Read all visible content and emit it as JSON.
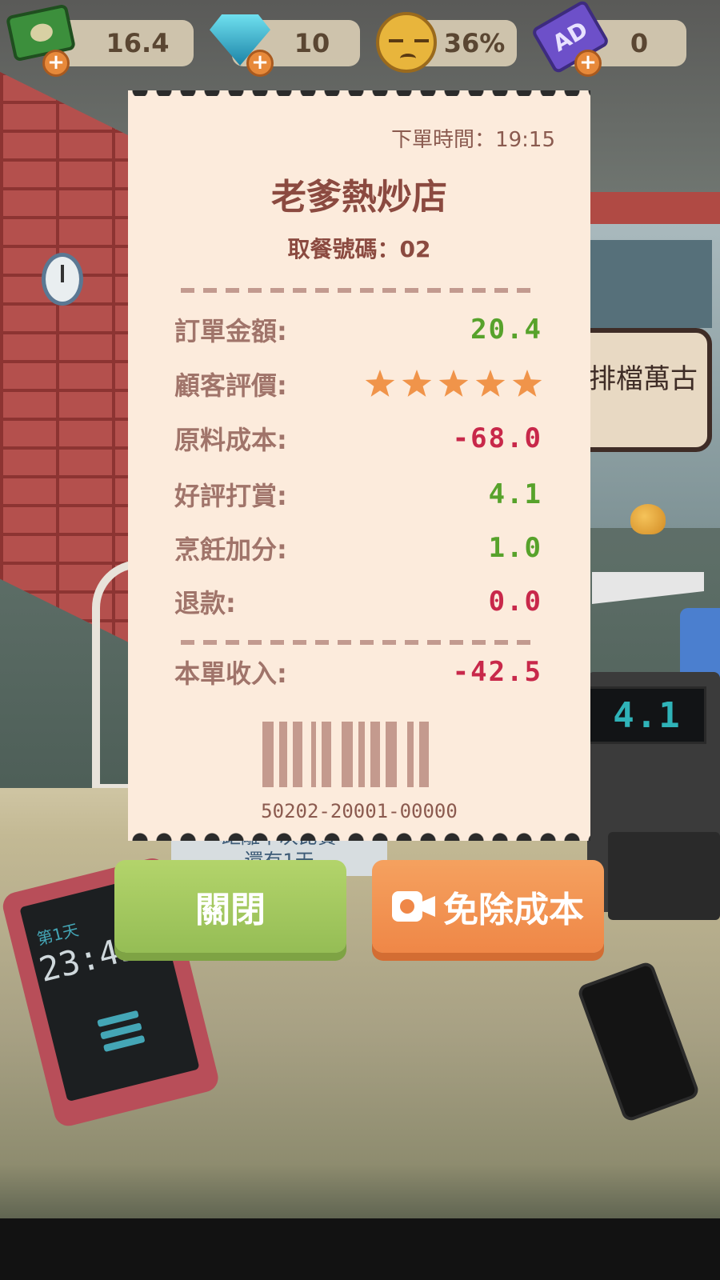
{
  "hud": {
    "cash": "16.4",
    "gems": "10",
    "satisfaction": "36%",
    "ad_tickets": "0",
    "ad_icon_text": "AD"
  },
  "scene": {
    "side_sign": "排檔萬古",
    "next_match_line1": "距離下次比賽",
    "next_match_line2": "還有1天",
    "register_display": "4.1",
    "tablet_day": "第1天",
    "tablet_time": "23:45"
  },
  "receipt": {
    "order_time_label": "下單時間：",
    "order_time": "19:15",
    "shop_name": "老爹熱炒店",
    "pickup_label": "取餐號碼：",
    "pickup_number": "02",
    "rows": [
      {
        "label": "訂單金額:",
        "value": "20.4"
      },
      {
        "label": "顧客評價:",
        "stars": 5
      },
      {
        "label": "原料成本:",
        "value": "-68.0"
      },
      {
        "label": "好評打賞:",
        "value": "4.1"
      },
      {
        "label": "烹飪加分:",
        "value": "1.0"
      },
      {
        "label": "退款:",
        "value": "0.0"
      }
    ],
    "total_label": "本單收入:",
    "total_value": "-42.5",
    "barcode_number": "50202-20001-00000"
  },
  "buttons": {
    "close_label": "關閉",
    "waive_cost_label": "免除成本"
  },
  "colors": {
    "positive": "#57a22b",
    "negative": "#c8284a",
    "receipt_bg": "#fcebdc",
    "close_button": "#a8cb60",
    "ad_button": "#f29454"
  }
}
